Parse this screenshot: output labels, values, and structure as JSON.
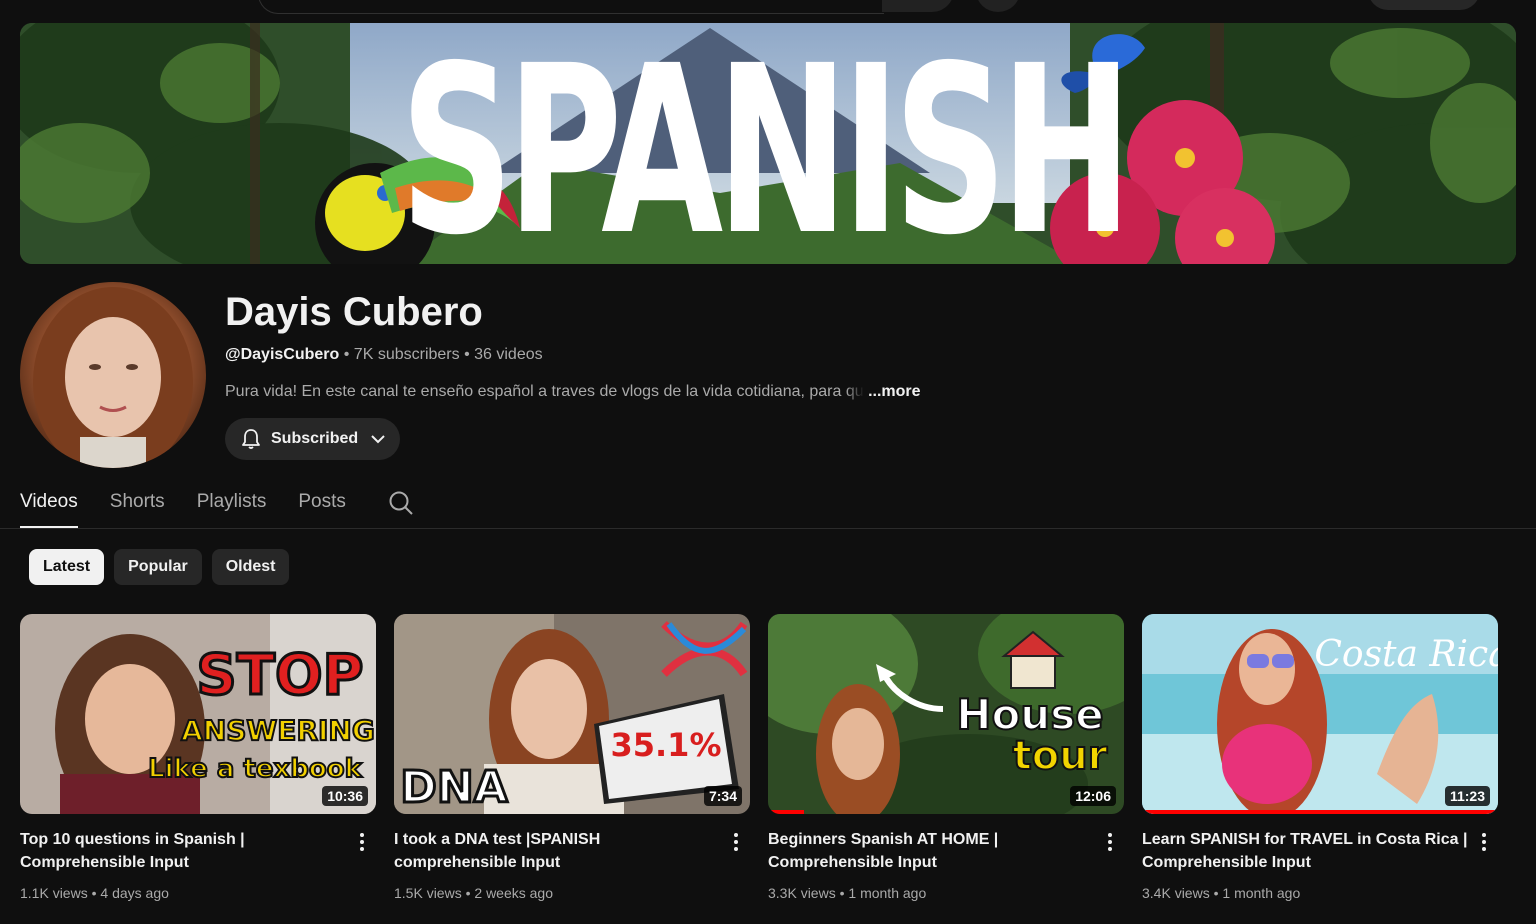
{
  "banner": {
    "title": "SPANISH"
  },
  "channel": {
    "name": "Dayis Cubero",
    "handle": "@DayisCubero",
    "subscribers": "7K subscribers",
    "videos_count": "36 videos",
    "separator": " • ",
    "description_visible": "Pura vida! En este canal te enseño español a traves de vlogs de la vida cotidiana, para ",
    "description_fade": "qu",
    "more_label": "...more",
    "subscribe_label": "Subscribed"
  },
  "tabs": [
    {
      "label": "Videos",
      "active": true
    },
    {
      "label": "Shorts"
    },
    {
      "label": "Playlists"
    },
    {
      "label": "Posts"
    }
  ],
  "chips": [
    {
      "label": "Latest",
      "selected": true
    },
    {
      "label": "Popular"
    },
    {
      "label": "Oldest"
    }
  ],
  "videos": [
    {
      "title": "Top 10 questions in Spanish | Comprehensible Input",
      "views": "1.1K views",
      "age": "4 days ago",
      "duration": "10:36",
      "thumb_text": [
        "STOP",
        "ANSWERING",
        "Like a texbook"
      ],
      "progress": 0
    },
    {
      "title": "I took a DNA test |SPANISH comprehensible Input",
      "views": "1.5K views",
      "age": "2 weeks ago",
      "duration": "7:34",
      "thumb_text": [
        "DNA",
        "35.1%"
      ],
      "progress": 0
    },
    {
      "title": "Beginners Spanish AT HOME | Comprehensible Input",
      "views": "3.3K views",
      "age": "1 month ago",
      "duration": "12:06",
      "thumb_text": [
        "House",
        "tour"
      ],
      "progress": 0.1
    },
    {
      "title": "Learn SPANISH for TRAVEL in Costa Rica | Comprehensible Input",
      "views": "3.4K views",
      "age": "1 month ago",
      "duration": "11:23",
      "thumb_text": [
        "Costa Rica"
      ],
      "progress": 1.0
    }
  ],
  "colors": {
    "background": "#0f0f0f",
    "progress": "#ff0000",
    "text_secondary": "#aaaaaa"
  }
}
